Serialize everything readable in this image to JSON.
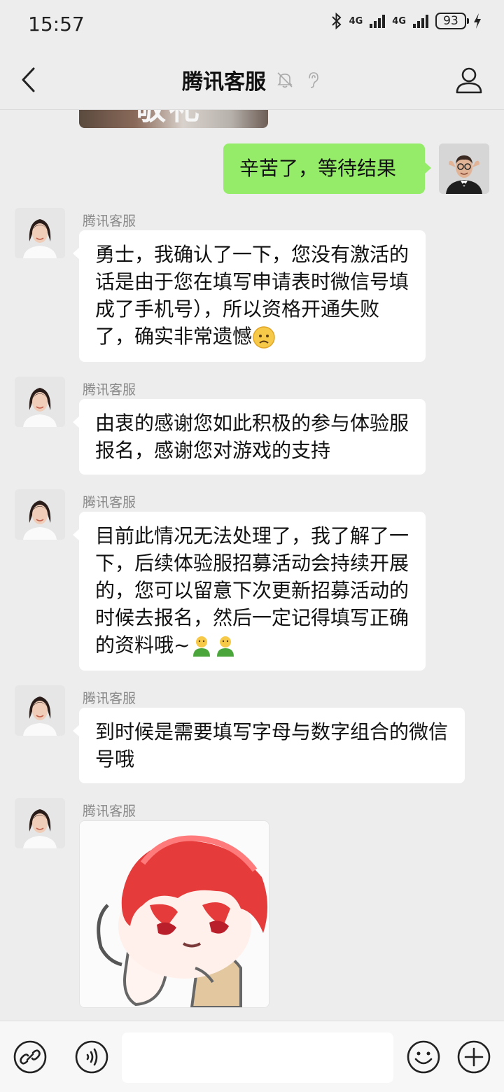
{
  "status_bar": {
    "time": "15:57",
    "network_1": "4G",
    "network_2": "4G",
    "battery": "93"
  },
  "header": {
    "title": "腾讯客服"
  },
  "messages": [
    {
      "side": "right",
      "text": "辛苦了，等待结果"
    },
    {
      "side": "left",
      "sender": "腾讯客服",
      "text": "勇士，我确认了一下，您没有激活的话是由于您在填写申请表时微信号填成了手机号），所以资格开通失败了，确实非常遗憾",
      "emoji": "frown-emoji"
    },
    {
      "side": "left",
      "sender": "腾讯客服",
      "text": "由衷的感谢您如此积极的参与体验服报名，感谢您对游戏的支持"
    },
    {
      "side": "left",
      "sender": "腾讯客服",
      "text": "目前此情况无法处理了，我了解了一下，后续体验服招募活动会持续开展的，您可以留意下次更新招募活动的时候去报名，然后一定记得填写正确的资料哦~",
      "emoji": "hug-emoji"
    },
    {
      "side": "left",
      "sender": "腾讯客服",
      "text": "到时候是需要填写字母与数字组合的微信号哦"
    },
    {
      "side": "left",
      "sender": "腾讯客服",
      "type": "sticker",
      "sticker": "red-haired-cartoon-sticker"
    }
  ],
  "top_image_caption": "敬礼",
  "colors": {
    "self_bubble": "#95ec69",
    "other_bubble": "#ffffff",
    "background": "#ededed"
  }
}
